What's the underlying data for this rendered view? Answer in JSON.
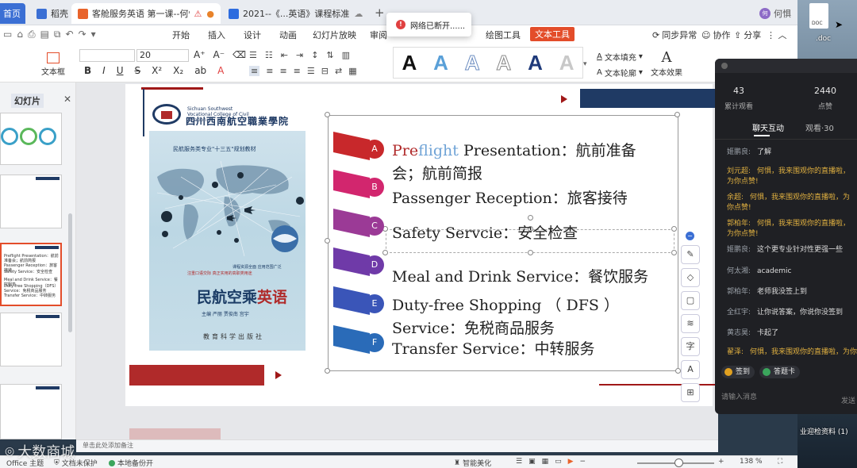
{
  "tabs": {
    "home": "首页",
    "daoke": "稻壳",
    "active": "客舱服务英语 第一课--何惧",
    "doc": "2021--《...英语》课程标准"
  },
  "user": {
    "name": "何惧",
    "avatar": "何惧"
  },
  "menu": [
    "开始",
    "插入",
    "设计",
    "动画",
    "幻灯片放映",
    "审阅",
    "绘图工具",
    "文本工具"
  ],
  "menu_right": {
    "sync": "同步异常",
    "collab": "协作",
    "share": "分享"
  },
  "toast": "网络已断开......",
  "ribbon": {
    "textbox": "文本框",
    "font_size": "20",
    "text_fill": "文本填充",
    "text_outline": "文本轮廓",
    "text_effect": "文本效果"
  },
  "left_panel": {
    "tab1": "幻灯片",
    "thumb_texts": [
      "Preflight Presentation：航前准备会；航前简报",
      "Passenger Reception：旅客接待",
      "Safety Service：安全检查",
      "Meal and Drink Service：餐饮服务",
      "Duty-free Shopping（DFS）Service：免税商品服务",
      "Transfer Service：中转服务"
    ]
  },
  "slide": {
    "college_en": "Sichuan Southwest Vocational College of Civil Aviation",
    "college_cn": "四川西南航空職業學院",
    "book": {
      "series": "民航服务类专业\"十三五\"规划教材",
      "subtitle1": "课程资源全面 应用范围广泛",
      "subtitle2": "注重口语交际 真正实用的高职类用途",
      "title_main": "民航空乘",
      "title_hl": "英语",
      "authors": "主编 严丽 贾俊南 宫宇",
      "publisher": "教育科学出版社"
    },
    "items": [
      {
        "letter": "A",
        "pre_red": "Pre",
        "pre_blue": "flight",
        "text": " Presentation：航前准备",
        "line2": "会；航前简报",
        "color": "#c8282b"
      },
      {
        "letter": "B",
        "text": "Passenger Reception：旅客接待",
        "color": "#d2266e"
      },
      {
        "letter": "C",
        "text": "Safety Servcie：安全检查",
        "color": "#9b3a96"
      },
      {
        "letter": "D",
        "text": "Meal and Drink Service：餐饮服务",
        "color": "#6f3aa8"
      },
      {
        "letter": "E",
        "text": "Duty-free Shopping （ DFS ）",
        "line2": "Service：免税商品服务",
        "color": "#3a55b8"
      },
      {
        "letter": "F",
        "text": "Transfer Service：中转服务",
        "color": "#2a6bb8"
      }
    ]
  },
  "note_bar": "单击此处添加备注",
  "status": {
    "theme": "Office 主题",
    "protect": "文档未保护",
    "backup": "本地备份开",
    "beautify": "智能美化",
    "zoom": "138 %"
  },
  "live": {
    "viewers": "43",
    "viewers_label": "累计观看",
    "likes": "2440",
    "likes_label": "点赞",
    "tab_chat": "聊天互动",
    "tab_watch": "观看·30",
    "messages": [
      {
        "name": "姬鹏良:",
        "text": "了解",
        "gold": false
      },
      {
        "name": "刘元超:",
        "text": "何惧，我来围观你的直播啦，为你点赞!",
        "gold": true
      },
      {
        "name": "余超:",
        "text": "何惧，我来围观你的直播啦，为你点赞!",
        "gold": true
      },
      {
        "name": "郭柏年:",
        "text": "何惧，我来围观你的直播啦，为你点赞!",
        "gold": true
      },
      {
        "name": "姬鹏良:",
        "text": "这个更专业针对性更强一些",
        "gold": false
      },
      {
        "name": "何太湘:",
        "text": "academic",
        "gold": false
      },
      {
        "name": "郭柏年:",
        "text": "老师我没签上到",
        "gold": false
      },
      {
        "name": "全红宇:",
        "text": "让你说答案，你说你没签到",
        "gold": false
      },
      {
        "name": "黄志昊:",
        "text": "卡起了",
        "gold": false
      },
      {
        "name": "翟泽:",
        "text": "何惧，我来围观你的直播啦，为你",
        "gold": true
      }
    ],
    "chip_sign": "签到",
    "chip_answer": "答题卡",
    "input_placeholder": "请输入消息",
    "send": "发送"
  },
  "desktop": {
    "doc_label": ".doc",
    "folder_label": "业迎检资料 (1)"
  },
  "watermark": "大数商城"
}
